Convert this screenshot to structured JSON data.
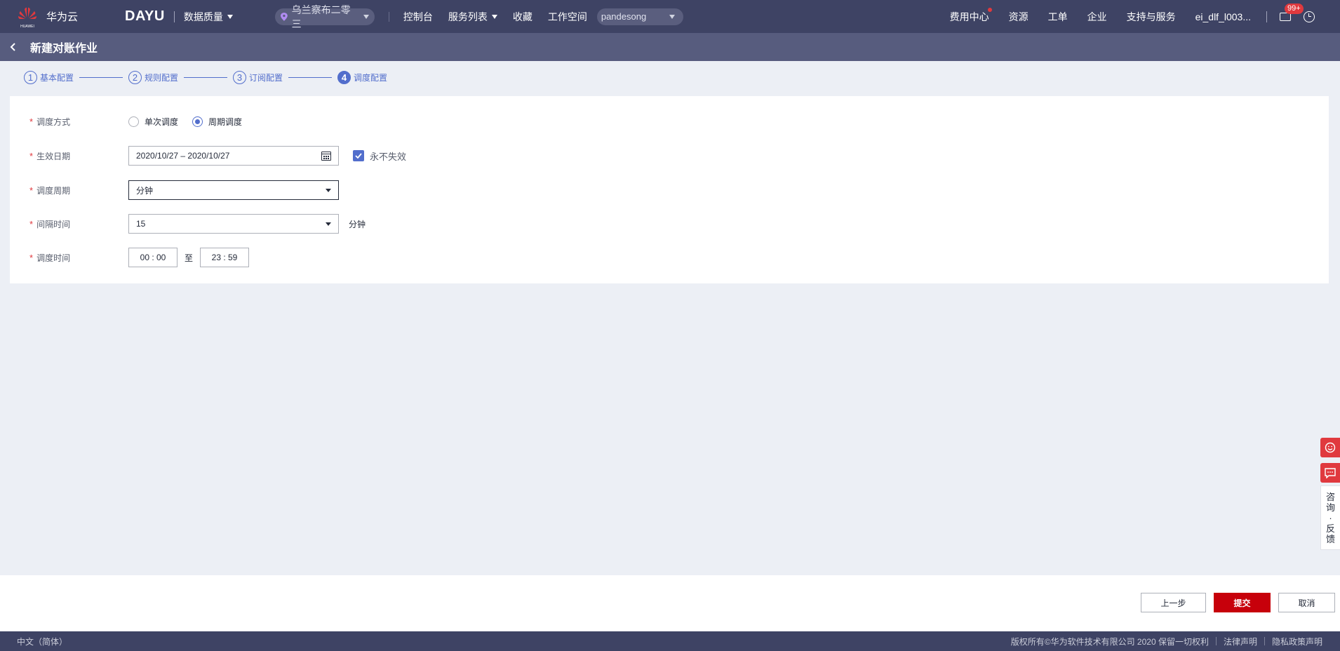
{
  "topbar": {
    "brand_text": "华为云",
    "brand_subtext": "HUAWEI",
    "product": "DAYU",
    "module": "数据质量",
    "region": "乌兰察布二零三",
    "links": [
      "控制台",
      "服务列表",
      "收藏",
      "工作空间"
    ],
    "workspace": "pandesong",
    "right_links": [
      "费用中心",
      "资源",
      "工单",
      "企业",
      "支持与服务",
      "ei_dlf_l003..."
    ],
    "badge": "99+",
    "colors": {
      "bar": "#3e4364",
      "badge": "#e0393e"
    }
  },
  "page": {
    "title": "新建对账作业"
  },
  "steps": [
    {
      "num": "1",
      "label": "基本配置"
    },
    {
      "num": "2",
      "label": "规则配置"
    },
    {
      "num": "3",
      "label": "订阅配置"
    },
    {
      "num": "4",
      "label": "调度配置",
      "active": true
    }
  ],
  "form": {
    "schedule_mode": {
      "label": "调度方式",
      "options": [
        "单次调度",
        "周期调度"
      ],
      "selected": "周期调度"
    },
    "effective_date": {
      "label": "生效日期",
      "value": "2020/10/27 – 2020/10/27",
      "never_expire_label": "永不失效",
      "never_expire_checked": true
    },
    "schedule_period": {
      "label": "调度周期",
      "value": "分钟"
    },
    "interval": {
      "label": "间隔时间",
      "value": "15",
      "unit": "分钟"
    },
    "schedule_time": {
      "label": "调度时间",
      "start": "00 : 00",
      "separator": "至",
      "end": "23 : 59"
    }
  },
  "actions": {
    "prev": "上一步",
    "submit": "提交",
    "cancel": "取消"
  },
  "footer": {
    "language": "中文（简体）",
    "copyright": "版权所有©华为软件技术有限公司 2020 保留一切权利",
    "legal": "法律声明",
    "privacy": "隐私政策声明"
  },
  "side_widgets": {
    "feedback_chars": [
      "咨",
      "询",
      "·",
      "反",
      "馈"
    ]
  }
}
